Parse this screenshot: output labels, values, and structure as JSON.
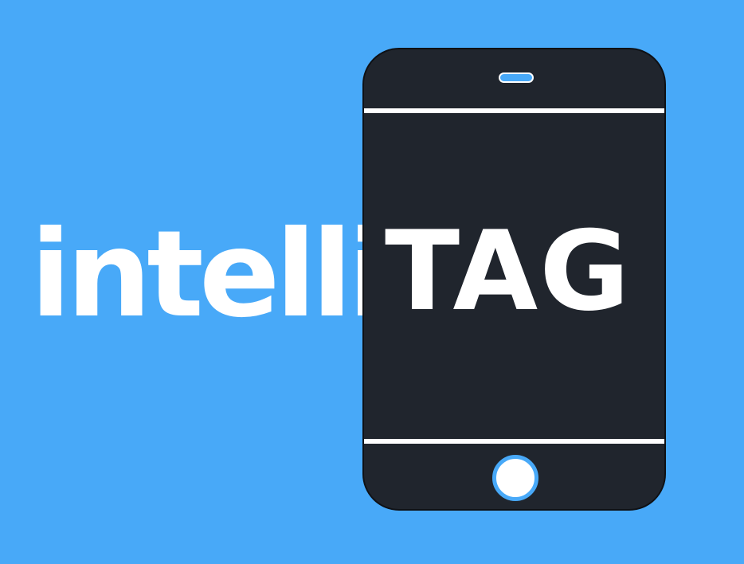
{
  "logo": {
    "text_left": "intelli",
    "text_right": "TAG",
    "colors": {
      "background": "#48a9f8",
      "phone_body": "#20252d",
      "text": "#ffffff",
      "accent": "#48a9f8"
    },
    "icons": [
      "smartphone-icon",
      "speaker-icon",
      "home-button-icon"
    ]
  }
}
